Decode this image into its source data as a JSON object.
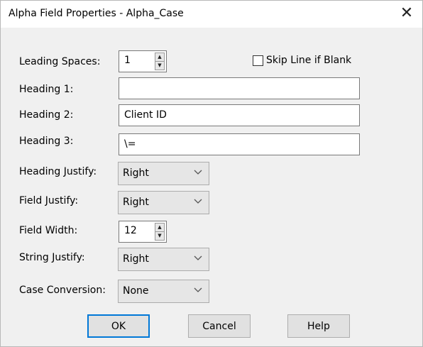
{
  "window": {
    "title": "Alpha Field Properties - Alpha_Case",
    "close_glyph": "✕"
  },
  "fields": {
    "leading_spaces": {
      "label": "Leading Spaces:",
      "value": "1"
    },
    "skip_line": {
      "label": "Skip Line if Blank",
      "checked": false
    },
    "heading1": {
      "label": "Heading 1:",
      "value": ""
    },
    "heading2": {
      "label": "Heading 2:",
      "value": "Client ID"
    },
    "heading3": {
      "label": "Heading 3:",
      "value": "\\="
    },
    "heading_justify": {
      "label": "Heading Justify:",
      "value": "Right"
    },
    "field_justify": {
      "label": "Field Justify:",
      "value": "Right"
    },
    "field_width": {
      "label": "Field Width:",
      "value": "12"
    },
    "string_justify": {
      "label": "String Justify:",
      "value": "Right"
    },
    "case_conversion": {
      "label": "Case Conversion:",
      "value": "None"
    }
  },
  "buttons": {
    "ok": "OK",
    "cancel": "Cancel",
    "help": "Help"
  },
  "icons": {
    "spin_up": "▲",
    "spin_down": "▼",
    "dropdown": "chevron-down-icon"
  },
  "colors": {
    "dialog_bg": "#f0f0f0",
    "default_button_border": "#0078d7"
  }
}
